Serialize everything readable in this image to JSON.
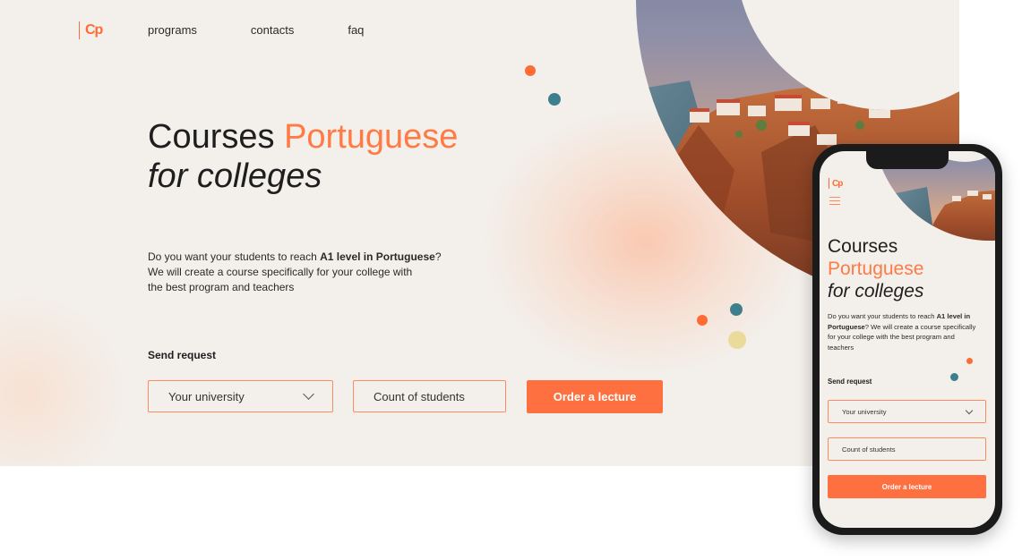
{
  "logo": {
    "text": "Cp"
  },
  "nav": {
    "items": [
      "programs",
      "contacts",
      "faq"
    ]
  },
  "hero": {
    "title_plain": "Courses ",
    "title_accent": "Portuguese",
    "title_italic": "for colleges",
    "desc_before": "Do you want your students to reach ",
    "desc_bold": "A1 level in Portuguese",
    "desc_after": "?",
    "desc_line2": "We will create a course specifically for your college with",
    "desc_line3": "the best program and teachers"
  },
  "form": {
    "send_label": "Send request",
    "university_value": "Your university",
    "students_value": "Count of students",
    "submit_label": "Order a lecture"
  },
  "mobile": {
    "title_line1": "Courses",
    "title_line2": "Portuguese",
    "title_line3": "for colleges",
    "desc_before": "Do you want your students to reach ",
    "desc_bold": "A1 level in Portuguese",
    "desc_after": "? We will create a course specifically for your college with the best program and teachers",
    "send_label": "Send request",
    "university_value": "Your university",
    "students_value": "Count of students",
    "submit_label": "Order a lecture"
  },
  "colors": {
    "accent": "#ff7040",
    "background": "#f3efea",
    "teal": "#3e7f8e",
    "yellow": "#eadb9a"
  },
  "icons": [
    "logo-mark",
    "chevron-down-icon",
    "hamburger-menu-icon",
    "decor-dot"
  ]
}
